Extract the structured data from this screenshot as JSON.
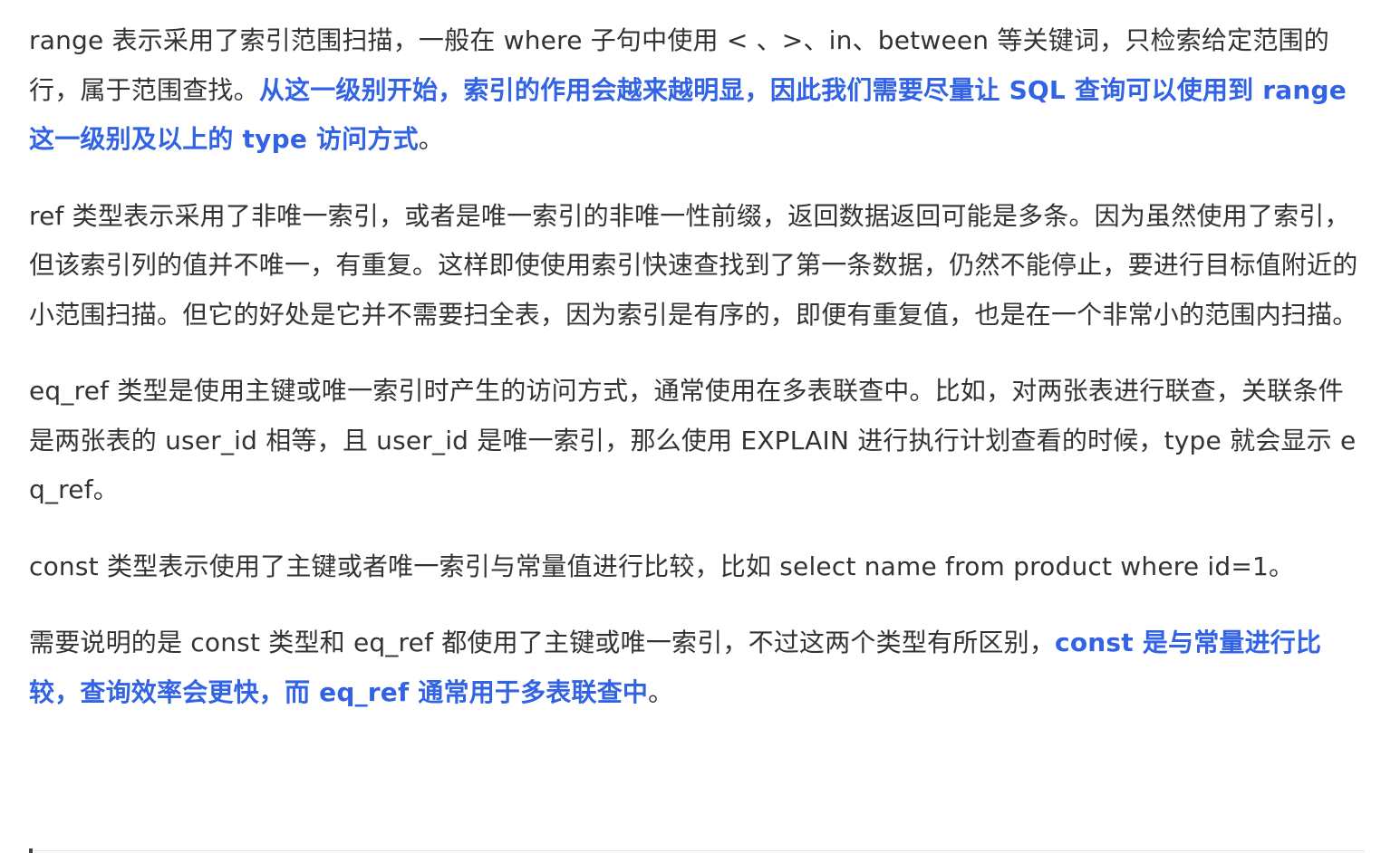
{
  "paragraphs": [
    {
      "plain": "range 表示采用了索引范围扫描，一般在 where 子句中使用 < 、>、in、between 等关键词，只检索给定范围的行，属于范围查找。",
      "emphasis": "从这一级别开始，索引的作用会越来越明显，因此我们需要尽量让 SQL 查询可以使用到 range 这一级别及以上的 type 访问方式",
      "tail": "。"
    },
    {
      "plain": "ref 类型表示采用了非唯一索引，或者是唯一索引的非唯一性前缀，返回数据返回可能是多条。因为虽然使用了索引，但该索引列的值并不唯一，有重复。这样即使使用索引快速查找到了第一条数据，仍然不能停止，要进行目标值附近的小范围扫描。但它的好处是它并不需要扫全表，因为索引是有序的，即便有重复值，也是在一个非常小的范围内扫描。"
    },
    {
      "plain": "eq_ref 类型是使用主键或唯一索引时产生的访问方式，通常使用在多表联查中。比如，对两张表进行联查，关联条件是两张表的 user_id 相等，且 user_id 是唯一索引，那么使用 EXPLAIN 进行执行计划查看的时候，type 就会显示 eq_ref。"
    },
    {
      "plain": "const 类型表示使用了主键或者唯一索引与常量值进行比较，比如 select name from product where id=1。"
    },
    {
      "plain": "需要说明的是 const 类型和 eq_ref 都使用了主键或唯一索引，不过这两个类型有所区别，",
      "emphasis": "const 是与常量进行比较，查询效率会更快，而 eq_ref 通常用于多表联查中",
      "tail": "。"
    }
  ],
  "colors": {
    "text": "#333333",
    "emphasis": "#3163e4",
    "background": "#ffffff"
  }
}
